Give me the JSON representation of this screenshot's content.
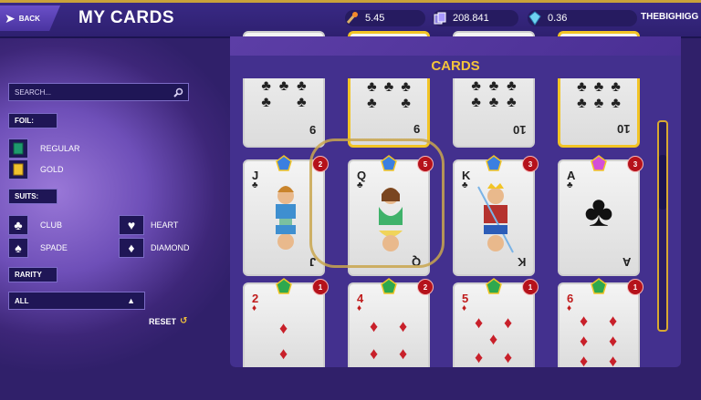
{
  "header": {
    "back_label": "BACK",
    "title": "MY CARDS",
    "stats": [
      {
        "icon": "fire-torch-icon",
        "value": "5.45"
      },
      {
        "icon": "card-stack-icon",
        "value": "208.841"
      },
      {
        "icon": "crystal-icon",
        "value": "0.36"
      }
    ],
    "username": "THEBIGHIGG"
  },
  "sidebar": {
    "search_placeholder": "SEARCH...",
    "foil_label": "FOIL:",
    "foil_options": [
      "REGULAR",
      "GOLD"
    ],
    "suits_label": "SUITS:",
    "suits": [
      "CLUB",
      "HEART",
      "SPADE",
      "DIAMOND"
    ],
    "rarity_label": "RARITY",
    "rarity_value": "ALL",
    "reset_label": "RESET"
  },
  "panel": {
    "title": "CARDS"
  },
  "cards_row_top": [
    {
      "rank": "9",
      "gold": false
    },
    {
      "rank": "9",
      "gold": true
    },
    {
      "rank": "10",
      "gold": false
    },
    {
      "rank": "10",
      "gold": true
    }
  ],
  "cards_row_mid": [
    {
      "rank": "J",
      "suit": "♣",
      "count": "2",
      "gem": "blue"
    },
    {
      "rank": "Q",
      "suit": "♣",
      "count": "5",
      "gem": "blue"
    },
    {
      "rank": "K",
      "suit": "♣",
      "count": "3",
      "gem": "blue"
    },
    {
      "rank": "A",
      "suit": "♣",
      "count": "3",
      "gem": "pink"
    }
  ],
  "cards_row_bottom": [
    {
      "rank": "2",
      "suit": "♦",
      "count": "1"
    },
    {
      "rank": "4",
      "suit": "♦",
      "count": "2"
    },
    {
      "rank": "5",
      "suit": "♦",
      "count": "1"
    },
    {
      "rank": "6",
      "suit": "♦",
      "count": "1"
    }
  ],
  "colors": {
    "accent_gold": "#f4c43a",
    "badge_red": "#b5121b",
    "panel_purple": "#43308e"
  }
}
